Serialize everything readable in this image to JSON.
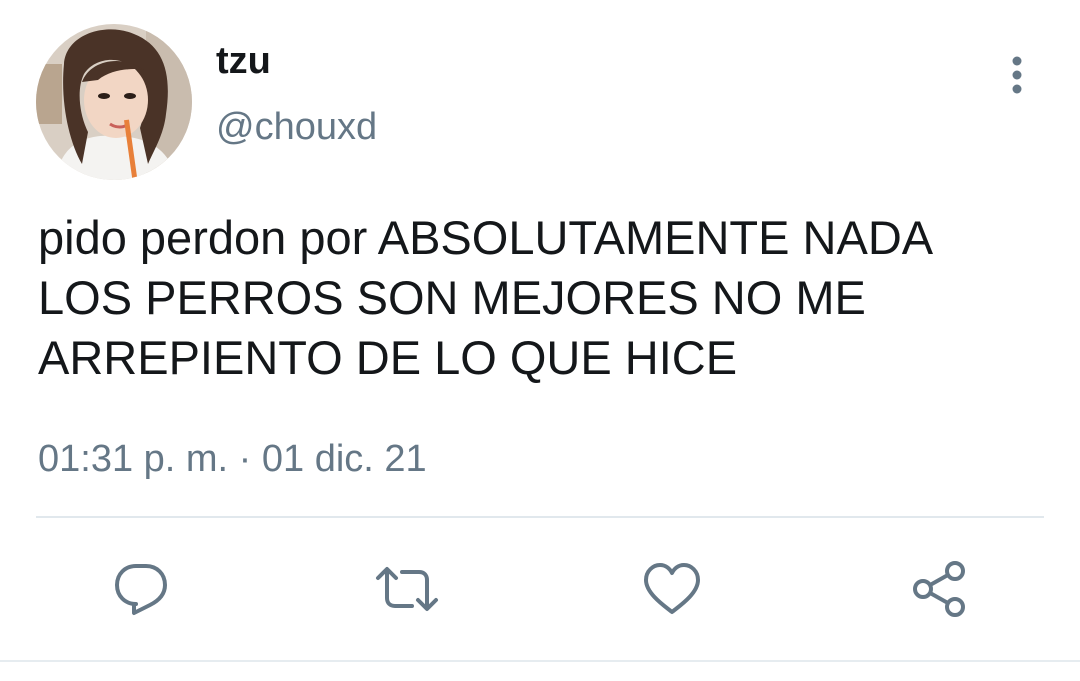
{
  "tweet": {
    "display_name": "tzu",
    "handle": "@chouxd",
    "text_lines": [
      "pido perdon por ABSOLUTAMENTE NADA",
      "LOS PERROS SON MEJORES NO ME",
      "ARREPIENTO DE LO QUE HICE"
    ],
    "timestamp": "01:31 p. m. · 01 dic. 21"
  },
  "icons": {
    "more": "more-vertical-icon",
    "reply": "reply-icon",
    "retweet": "retweet-icon",
    "like": "heart-icon",
    "share": "share-icon"
  },
  "colors": {
    "text_primary": "#14171a",
    "text_secondary": "#657786",
    "divider": "#e1e8ed"
  }
}
